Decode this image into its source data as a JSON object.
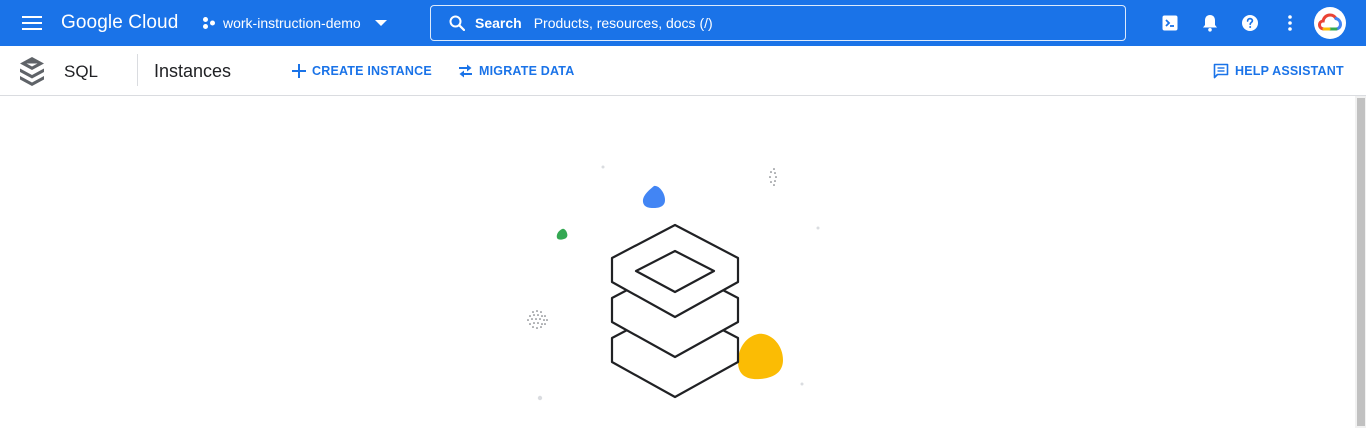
{
  "header": {
    "brand": "Google Cloud",
    "project_name": "work-instruction-demo",
    "search": {
      "label": "Search",
      "placeholder": "Products, resources, docs (/)"
    },
    "icons": [
      "menu-icon",
      "project-icon",
      "dropdown-arrow-icon",
      "search-icon",
      "cloud-shell-icon",
      "notifications-bell-icon",
      "help-icon",
      "more-vert-icon",
      "google-cloud-avatar-icon"
    ]
  },
  "subheader": {
    "product": "SQL",
    "page_title": "Instances",
    "actions": {
      "create": "CREATE INSTANCE",
      "migrate": "MIGRATE DATA",
      "help": "HELP ASSISTANT"
    }
  },
  "colors": {
    "topbar": "#1a73e8",
    "accent": "#1a73e8",
    "blob_blue": "#4285f4",
    "blob_green": "#34a853",
    "blob_yellow": "#fbbc04",
    "outline": "#202124"
  }
}
